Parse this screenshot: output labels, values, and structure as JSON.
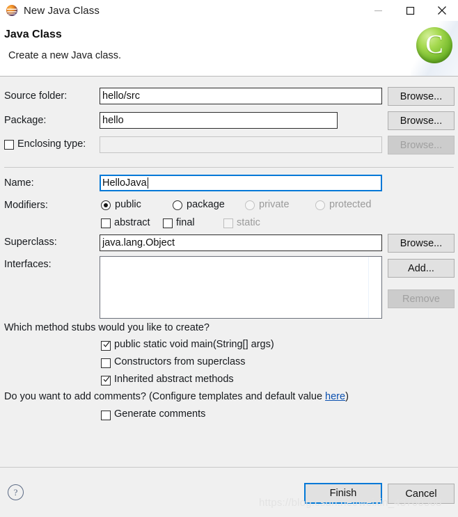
{
  "window": {
    "title": "New Java Class",
    "icon": "eclipse-sphere-icon",
    "controls": {
      "minimize": "minimize-icon",
      "maximize": "maximize-icon",
      "close": "close-icon"
    }
  },
  "header": {
    "title": "Java Class",
    "description": "Create a new Java class.",
    "logo_letter": "C"
  },
  "form": {
    "source_folder": {
      "label": "Source folder:",
      "value": "hello/src",
      "browse": "Browse..."
    },
    "package": {
      "label": "Package:",
      "value": "hello",
      "browse": "Browse..."
    },
    "enclosing_type": {
      "label": "Enclosing type:",
      "value": "",
      "checked": false,
      "enabled": false,
      "browse": "Browse..."
    },
    "name": {
      "label": "Name:",
      "value": "HelloJava",
      "focused": true
    },
    "modifiers": {
      "label": "Modifiers:",
      "access": [
        {
          "label": "public",
          "selected": true,
          "enabled": true
        },
        {
          "label": "package",
          "selected": false,
          "enabled": true
        },
        {
          "label": "private",
          "selected": false,
          "enabled": false
        },
        {
          "label": "protected",
          "selected": false,
          "enabled": false
        }
      ],
      "flags": [
        {
          "label": "abstract",
          "checked": false,
          "enabled": true
        },
        {
          "label": "final",
          "checked": false,
          "enabled": true
        },
        {
          "label": "static",
          "checked": false,
          "enabled": false
        }
      ]
    },
    "superclass": {
      "label": "Superclass:",
      "value": "java.lang.Object",
      "browse": "Browse..."
    },
    "interfaces": {
      "label": "Interfaces:",
      "items": [],
      "add": "Add...",
      "remove": "Remove"
    }
  },
  "stubs": {
    "question": "Which method stubs would you like to create?",
    "options": [
      {
        "label": "public static void main(String[] args)",
        "checked": true
      },
      {
        "label": "Constructors from superclass",
        "checked": false
      },
      {
        "label": "Inherited abstract methods",
        "checked": true
      }
    ]
  },
  "comments": {
    "question_prefix": "Do you want to add comments? (Configure templates and default value ",
    "link": "here",
    "question_suffix": ")",
    "option": {
      "label": "Generate comments",
      "checked": false
    }
  },
  "footer": {
    "help": "?",
    "finish": "Finish",
    "cancel": "Cancel"
  },
  "watermark": "https://blog.csdn.net/weixin_43700568",
  "colors": {
    "accent": "#0078d7",
    "dialog_bg": "#f0f0f0",
    "link": "#0b50b0",
    "logo_green": "#8cc63f"
  }
}
